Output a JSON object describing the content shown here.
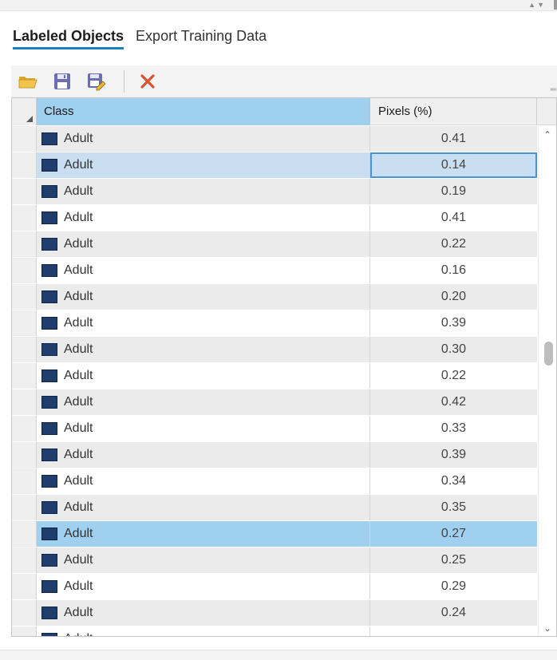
{
  "tabs": [
    {
      "label": "Labeled Objects",
      "active": true
    },
    {
      "label": "Export Training Data",
      "active": false
    }
  ],
  "toolbar": {
    "buttons": [
      {
        "icon": "open-folder-icon",
        "color": "#e8b83a"
      },
      {
        "icon": "save-icon",
        "color": "#6b6fb0"
      },
      {
        "icon": "save-as-icon",
        "color": "#6b6fb0"
      },
      {
        "icon": "delete-icon",
        "color": "#d9532c"
      }
    ]
  },
  "grid": {
    "columns": [
      "Class",
      "Pixels (%)"
    ],
    "swatch_color": "#1f3e6d",
    "rows": [
      {
        "class": "Adult",
        "pixels": "0.41",
        "state": "normal"
      },
      {
        "class": "Adult",
        "pixels": "0.14",
        "state": "selected-light"
      },
      {
        "class": "Adult",
        "pixels": "0.19",
        "state": "normal"
      },
      {
        "class": "Adult",
        "pixels": "0.41",
        "state": "normal"
      },
      {
        "class": "Adult",
        "pixels": "0.22",
        "state": "normal"
      },
      {
        "class": "Adult",
        "pixels": "0.16",
        "state": "normal"
      },
      {
        "class": "Adult",
        "pixels": "0.20",
        "state": "normal"
      },
      {
        "class": "Adult",
        "pixels": "0.39",
        "state": "normal"
      },
      {
        "class": "Adult",
        "pixels": "0.30",
        "state": "normal"
      },
      {
        "class": "Adult",
        "pixels": "0.22",
        "state": "normal"
      },
      {
        "class": "Adult",
        "pixels": "0.42",
        "state": "normal"
      },
      {
        "class": "Adult",
        "pixels": "0.33",
        "state": "normal"
      },
      {
        "class": "Adult",
        "pixels": "0.39",
        "state": "normal"
      },
      {
        "class": "Adult",
        "pixels": "0.34",
        "state": "normal"
      },
      {
        "class": "Adult",
        "pixels": "0.35",
        "state": "normal"
      },
      {
        "class": "Adult",
        "pixels": "0.27",
        "state": "selected-strong"
      },
      {
        "class": "Adult",
        "pixels": "0.25",
        "state": "normal"
      },
      {
        "class": "Adult",
        "pixels": "0.29",
        "state": "normal"
      },
      {
        "class": "Adult",
        "pixels": "0.24",
        "state": "normal"
      },
      {
        "class": "Adult",
        "pixels": "",
        "state": "normal"
      }
    ]
  },
  "colors": {
    "accent": "#1a7fc1",
    "header_selected": "#9fd0ef",
    "row_selected_light": "#c9dff1"
  }
}
